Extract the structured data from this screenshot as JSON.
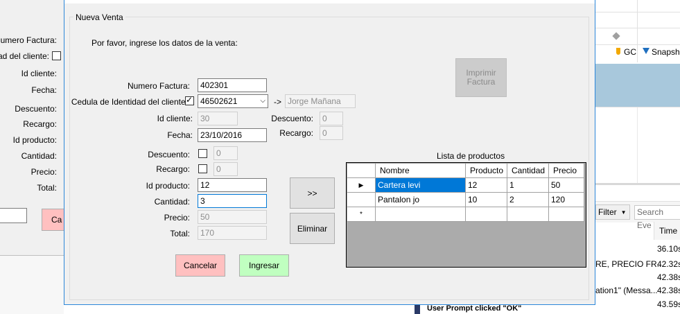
{
  "background_form": {
    "labels": [
      "Numero Factura:",
      "tidad del cliente:",
      "Id cliente:",
      "Fecha:",
      "Descuento:",
      "Recargo:",
      "Id producto:",
      "Cantidad:",
      "Precio:",
      "Total:"
    ],
    "cancel_partial": "Ca"
  },
  "right_app": {
    "gc_label": "GC",
    "snapshot_label": "Snapsho",
    "filter_label": "Filter",
    "search_placeholder": "Search Eve",
    "time_header": "Time",
    "rows": [
      {
        "text": "",
        "time": "36.10s"
      },
      {
        "text": "RE, PRECIO FR...",
        "time": "42.32s"
      },
      {
        "text": "",
        "time": "42.38s"
      },
      {
        "text": "ation1\" (Messa...",
        "time": "42.38s"
      },
      {
        "text": "User Prompt clicked \"OK\"",
        "time": "43.59s"
      }
    ]
  },
  "dialog": {
    "group_title": "Nueva Venta",
    "instruction": "Por favor, ingrese los datos de la venta:",
    "labels": {
      "numero_factura": "Numero Factura:",
      "cedula": "Cedula de Identidad del cliente:",
      "arrow": "->",
      "id_cliente": "Id cliente:",
      "fecha": "Fecha:",
      "descuento": "Descuento:",
      "recargo": "Recargo:",
      "descuento2": "Descuento:",
      "recargo2": "Recargo:",
      "id_producto": "Id producto:",
      "cantidad": "Cantidad:",
      "precio": "Precio:",
      "total": "Total:",
      "lista": "Lista de productos"
    },
    "values": {
      "numero_factura": "402301",
      "cedula": "46502621",
      "cliente_nombre": "Jorge Mañana",
      "id_cliente": "30",
      "fecha": "23/10/2016",
      "descuento_info": "0",
      "recargo_info": "0",
      "descuento": "0",
      "recargo": "0",
      "id_producto": "12",
      "cantidad": "3",
      "precio": "50",
      "total": "170"
    },
    "buttons": {
      "imprimir": "Imprimir Factura",
      "add": ">>",
      "eliminar": "Eliminar",
      "cancelar": "Cancelar",
      "ingresar": "Ingresar"
    },
    "grid": {
      "headers": [
        "Nombre",
        "Producto",
        "Cantidad",
        "Precio"
      ],
      "rows": [
        {
          "nombre": "Cartera levi",
          "producto": "12",
          "cantidad": "1",
          "precio": "50"
        },
        {
          "nombre": "Pantalon jo",
          "producto": "10",
          "cantidad": "2",
          "precio": "120"
        }
      ],
      "new_row_marker": "*"
    },
    "colors": {
      "cancel_bg": "#ffc0c0",
      "ingresar_bg": "#c0ffc0",
      "selected": "#0078d7",
      "window_border": "#2b86d9"
    }
  }
}
